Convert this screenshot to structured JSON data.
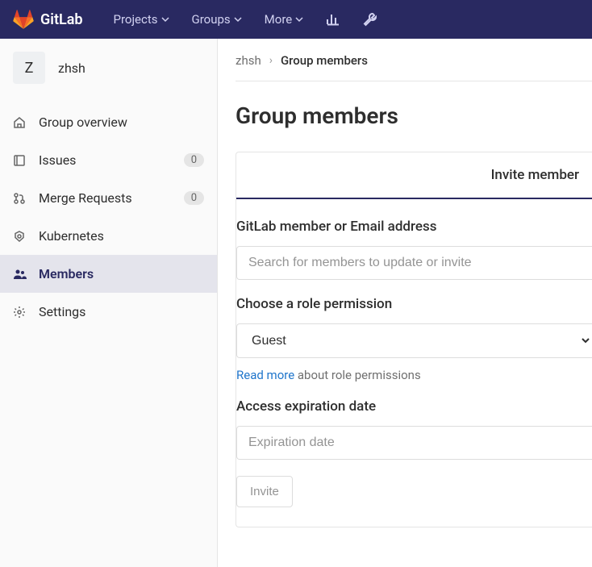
{
  "header": {
    "brand": "GitLab",
    "nav": [
      "Projects",
      "Groups",
      "More"
    ]
  },
  "sidebar": {
    "group_initial": "Z",
    "group_name": "zhsh",
    "items": [
      {
        "label": "Group overview",
        "badge": null
      },
      {
        "label": "Issues",
        "badge": "0"
      },
      {
        "label": "Merge Requests",
        "badge": "0"
      },
      {
        "label": "Kubernetes",
        "badge": null
      },
      {
        "label": "Members",
        "badge": null
      },
      {
        "label": "Settings",
        "badge": null
      }
    ]
  },
  "breadcrumb": {
    "root": "zhsh",
    "current": "Group members"
  },
  "page": {
    "title": "Group members"
  },
  "tab": {
    "label": "Invite member"
  },
  "form": {
    "member_label": "GitLab member or Email address",
    "member_placeholder": "Search for members to update or invite",
    "role_label": "Choose a role permission",
    "role_value": "Guest",
    "read_more": "Read more",
    "role_help": " about role permissions",
    "expiration_label": "Access expiration date",
    "expiration_placeholder": "Expiration date",
    "invite_button": "Invite"
  }
}
